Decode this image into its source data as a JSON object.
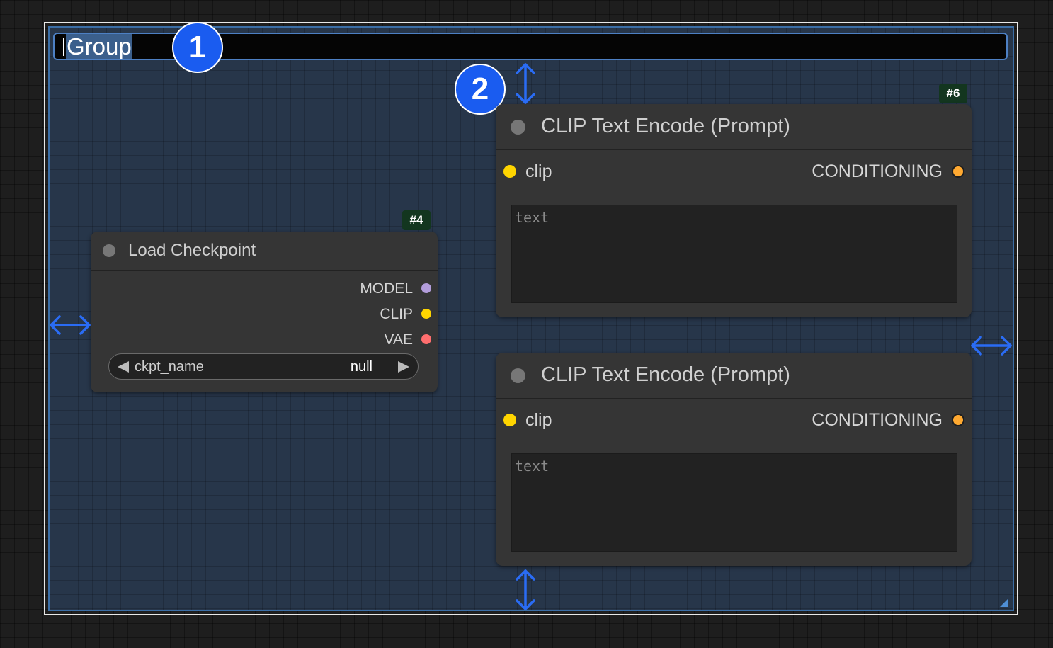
{
  "group": {
    "title": "Group"
  },
  "badges": [
    "1",
    "2"
  ],
  "nodes": {
    "load_checkpoint": {
      "id": "#4",
      "title": "Load Checkpoint",
      "outputs": [
        {
          "label": "MODEL",
          "color": "#b39ddb"
        },
        {
          "label": "CLIP",
          "color": "#ffd500"
        },
        {
          "label": "VAE",
          "color": "#ff6e6e"
        }
      ],
      "widget": {
        "name": "ckpt_name",
        "value": "null"
      }
    },
    "clip_encode_top": {
      "id": "#6",
      "title": "CLIP Text Encode (Prompt)",
      "input": {
        "label": "clip",
        "color": "#ffd500"
      },
      "output": {
        "label": "CONDITIONING",
        "color": "#ffa931"
      },
      "placeholder": "text"
    },
    "clip_encode_bottom": {
      "title": "CLIP Text Encode (Prompt)",
      "input": {
        "label": "clip",
        "color": "#ffd500"
      },
      "output": {
        "label": "CONDITIONING",
        "color": "#ffa931"
      },
      "placeholder": "text"
    }
  },
  "colors": {
    "accent": "#1a5cf0",
    "group_border": "#3b6ea6",
    "node_bg": "#353535",
    "id_badge_bg": "#13361f"
  }
}
